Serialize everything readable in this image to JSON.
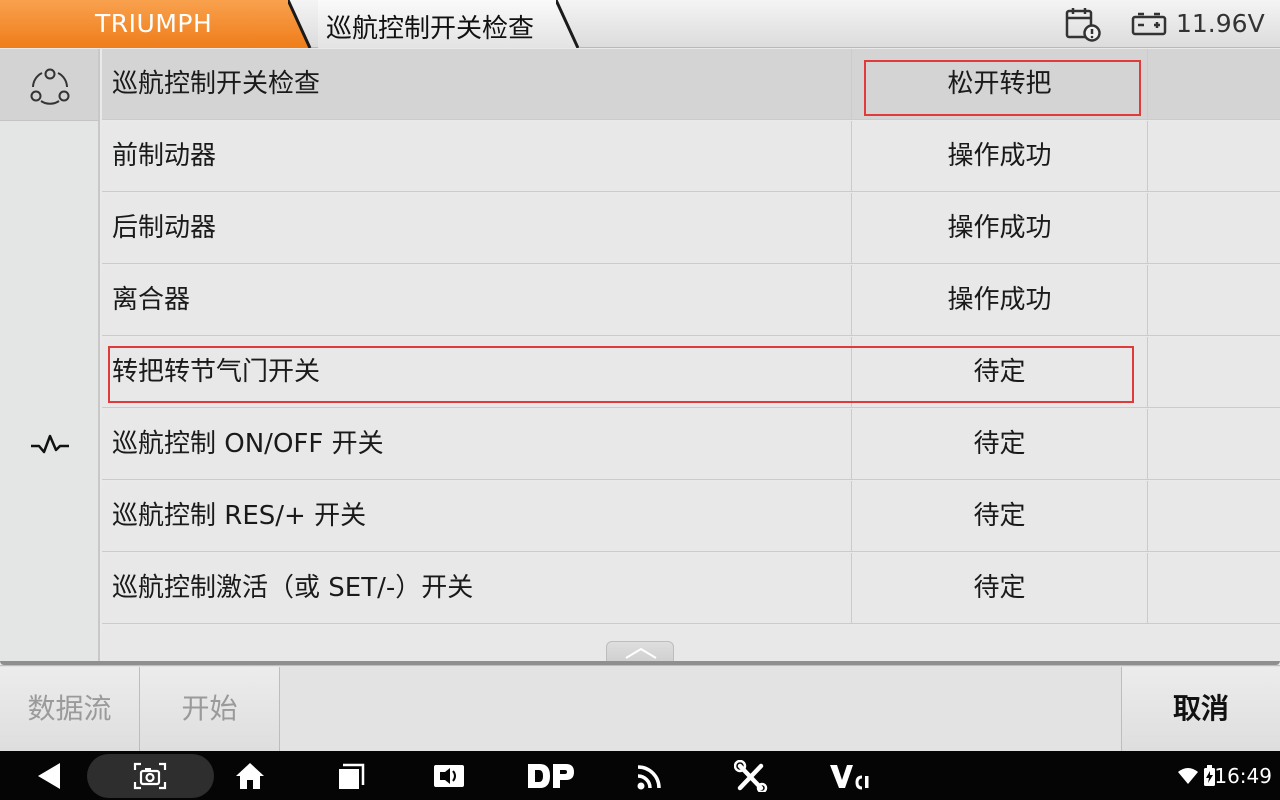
{
  "header": {
    "brand": "TRIUMPH",
    "page_title": "巡航控制开关检查",
    "voltage": "11.96V",
    "icons": [
      "calendar-alert-icon",
      "battery-icon"
    ]
  },
  "table": {
    "header_row": {
      "name": "巡航控制开关检查",
      "value": "松开转把"
    },
    "rows": [
      {
        "name": "前制动器",
        "value": "操作成功"
      },
      {
        "name": "后制动器",
        "value": "操作成功"
      },
      {
        "name": "离合器",
        "value": "操作成功"
      },
      {
        "name": "转把转节气门开关",
        "value": "待定"
      },
      {
        "name": "巡航控制 ON/OFF 开关",
        "value": "待定"
      },
      {
        "name": "巡航控制 RES/+ 开关",
        "value": "待定"
      },
      {
        "name": "巡航控制激活（或 SET/-）开关",
        "value": "待定"
      }
    ],
    "highlight_color": "#e03a3a"
  },
  "actions": {
    "data_stream": "数据流",
    "start": "开始",
    "cancel": "取消"
  },
  "navbar": {
    "time": "16:49",
    "icons": [
      "back-icon",
      "screenshot-icon",
      "home-icon",
      "recents-icon",
      "screen-mirror-icon",
      "dp-icon",
      "wireless-icon",
      "tools-icon",
      "vci-icon",
      "wifi-icon",
      "battery-charging-icon"
    ]
  },
  "colors": {
    "brand_orange": "#ef7d1a",
    "highlight_red": "#e03a3a"
  }
}
